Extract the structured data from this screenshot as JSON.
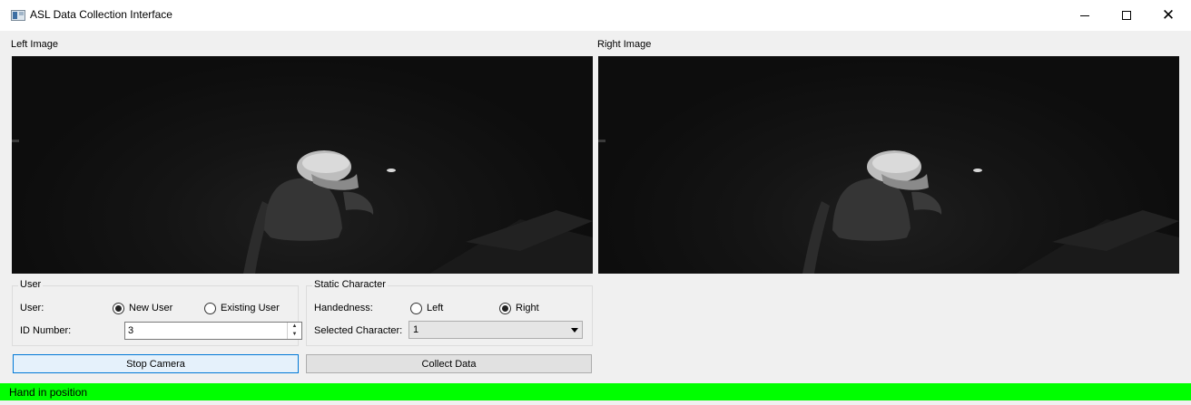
{
  "window": {
    "title": "ASL Data Collection Interface",
    "icon": "app-window-icon",
    "controls": [
      "minimize-icon",
      "maximize-icon",
      "close-icon"
    ]
  },
  "images": {
    "left_label": "Left Image",
    "right_label": "Right Image"
  },
  "user_group": {
    "title": "User",
    "user_label": "User:",
    "options": [
      {
        "label": "New User",
        "checked": true
      },
      {
        "label": "Existing User",
        "checked": false
      }
    ],
    "id_label": "ID Number:",
    "id_value": "3"
  },
  "static_group": {
    "title": "Static Character",
    "handedness_label": "Handedness:",
    "options": [
      {
        "label": "Left",
        "checked": false
      },
      {
        "label": "Right",
        "checked": true
      }
    ],
    "character_label": "Selected Character:",
    "character_value": "1"
  },
  "buttons": {
    "stop_camera": "Stop Camera",
    "collect_data": "Collect Data"
  },
  "status": {
    "text": "Hand in position",
    "color": "#00ff00"
  },
  "colors": {
    "focus_border": "#0078d7",
    "focus_fill": "#e5f1fb"
  }
}
